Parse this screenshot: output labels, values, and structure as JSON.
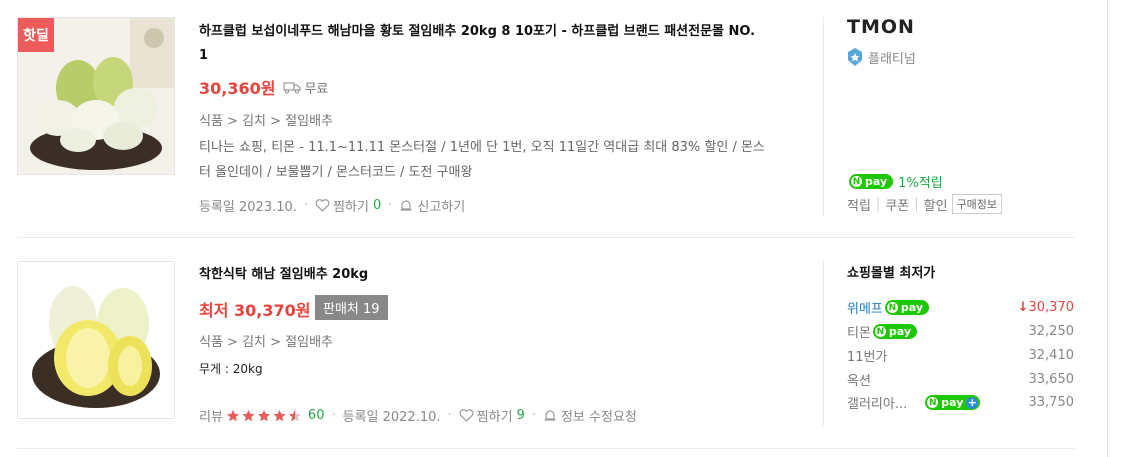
{
  "products": [
    {
      "badge": "핫딜",
      "title_line1": "하프클럽 보섭이네푸드 해남마을 황토 절임배추 20kg 8 10포기 - 하프클럽 브랜드 패션전문몰 NO.",
      "title_line2": "1",
      "price": "30,360원",
      "shipping": "무료",
      "category": "식품 > 김치 > 절임배추",
      "desc_line1": "티나는 쇼핑, 티몬 - 11.1~11.11 몬스터절 / 1년에 단 1번, 오직 11일간 역대급 최대 83% 할인 / 몬스",
      "desc_line2": "터 올인데이 / 보물뽑기 / 몬스터코드 / 도전 구매왕",
      "registered": "등록일 2023.10.",
      "wish_label": "찜하기",
      "wish_count": "0",
      "report": "신고하기",
      "seller_logo": "TMON",
      "seller_grade": "플래티넘",
      "npay_text": "pay",
      "npay_reward": "1%적립",
      "benefits": [
        "적립",
        "쿠폰",
        "할인"
      ],
      "purchase_info": "구매정보"
    },
    {
      "title": "착한식탁 해남 절임배추 20kg",
      "price": "최저 30,370원",
      "sellers_btn": "판매처 19",
      "category": "식품 > 김치 > 절임배추",
      "weight": "무게 : 20kg",
      "review_label": "리뷰",
      "review_rating": 4.5,
      "review_count": "60",
      "registered": "등록일 2022.10.",
      "wish_label": "찜하기",
      "wish_count": "9",
      "info_request": "정보 수정요청",
      "lowest_title": "쇼핑몰별 최저가",
      "malls": [
        {
          "name": "위메프",
          "npay": true,
          "plus": false,
          "price": "30,370",
          "lowest": true
        },
        {
          "name": "티몬",
          "npay": true,
          "plus": false,
          "price": "32,250",
          "lowest": false
        },
        {
          "name": "11번가",
          "npay": false,
          "plus": false,
          "price": "32,410",
          "lowest": false
        },
        {
          "name": "옥션",
          "npay": false,
          "plus": false,
          "price": "33,650",
          "lowest": false
        },
        {
          "name": "갤러리아...",
          "npay": true,
          "plus": true,
          "price": "33,750",
          "lowest": false
        }
      ]
    }
  ],
  "colors": {
    "price": "#e8443c",
    "npay": "#1ec800",
    "link": "#1f7bc0",
    "green": "#1faa45"
  }
}
